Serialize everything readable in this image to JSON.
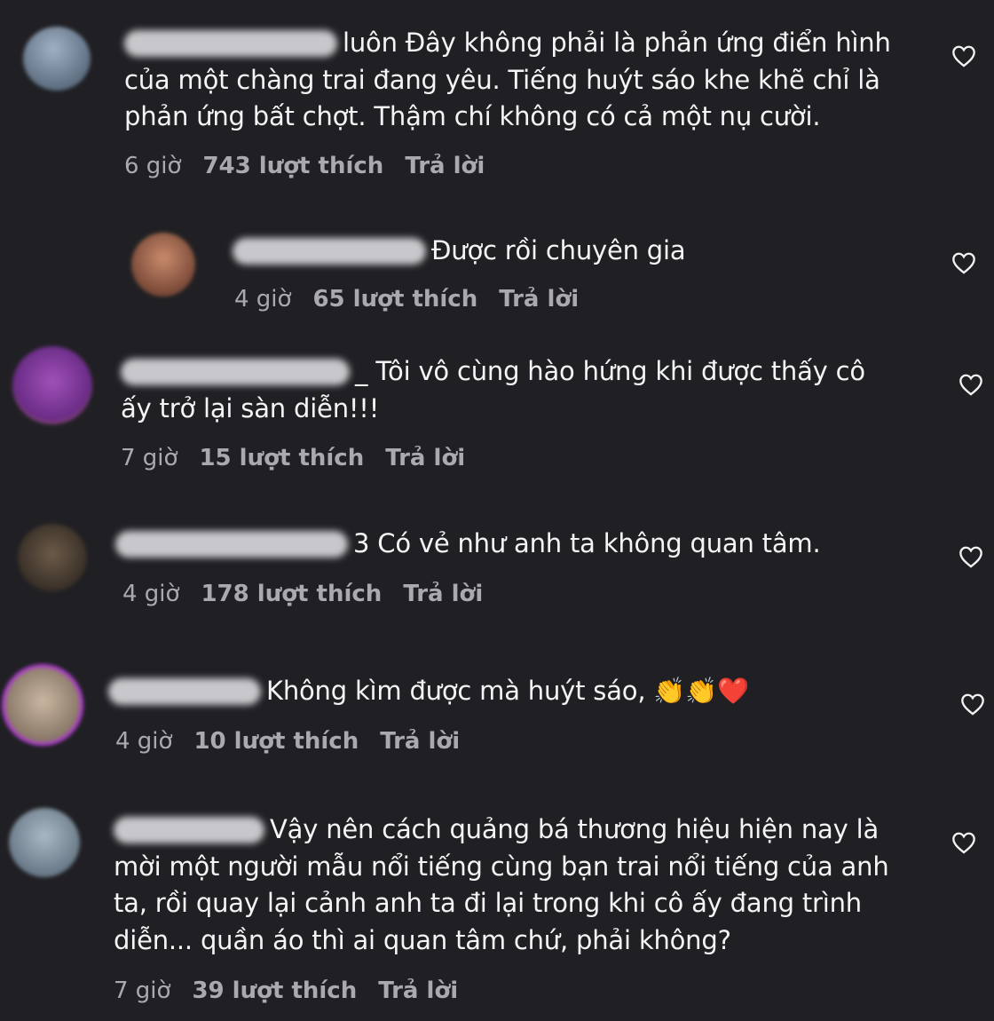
{
  "colors": {
    "background": "#202024",
    "text": "#f4f4f6",
    "meta": "#a9a9af"
  },
  "comments": [
    {
      "lines": [
        "luôn Đây không phải là phản ứng điển hình",
        "của một chàng trai đang yêu. Tiếng huýt sáo khe khẽ chỉ là",
        "phản ứng bất chợt. Thậm chí không có cả một nụ cười."
      ],
      "time": "6 giờ",
      "likes": "743 lượt thích",
      "reply": "Trả lời"
    },
    {
      "lines": [
        "Được rồi chuyên gia"
      ],
      "time": "4 giờ",
      "likes": "65 lượt thích",
      "reply": "Trả lời"
    },
    {
      "lines": [
        "_ Tôi vô cùng hào hứng khi được thấy cô",
        "ấy trở lại sàn diễn!!!"
      ],
      "time": "7 giờ",
      "likes": "15 lượt thích",
      "reply": "Trả lời"
    },
    {
      "lines": [
        "3 Có vẻ như anh ta không quan tâm."
      ],
      "time": "4 giờ",
      "likes": "178 lượt thích",
      "reply": "Trả lời"
    },
    {
      "lines": [
        "Không kìm được mà huýt sáo, 👏👏❤️"
      ],
      "time": "4 giờ",
      "likes": "10 lượt thích",
      "reply": "Trả lời"
    },
    {
      "lines": [
        "Vậy nên cách quảng bá thương hiệu hiện nay là",
        "mời một người mẫu nổi tiếng cùng bạn trai nổi tiếng của anh",
        "ta, rồi quay lại cảnh anh ta đi lại trong khi cô ấy đang trình",
        "diễn... quần áo thì ai quan tâm chứ, phải không?"
      ],
      "time": "7 giờ",
      "likes": "39 lượt thích",
      "reply": "Trả lời"
    }
  ]
}
